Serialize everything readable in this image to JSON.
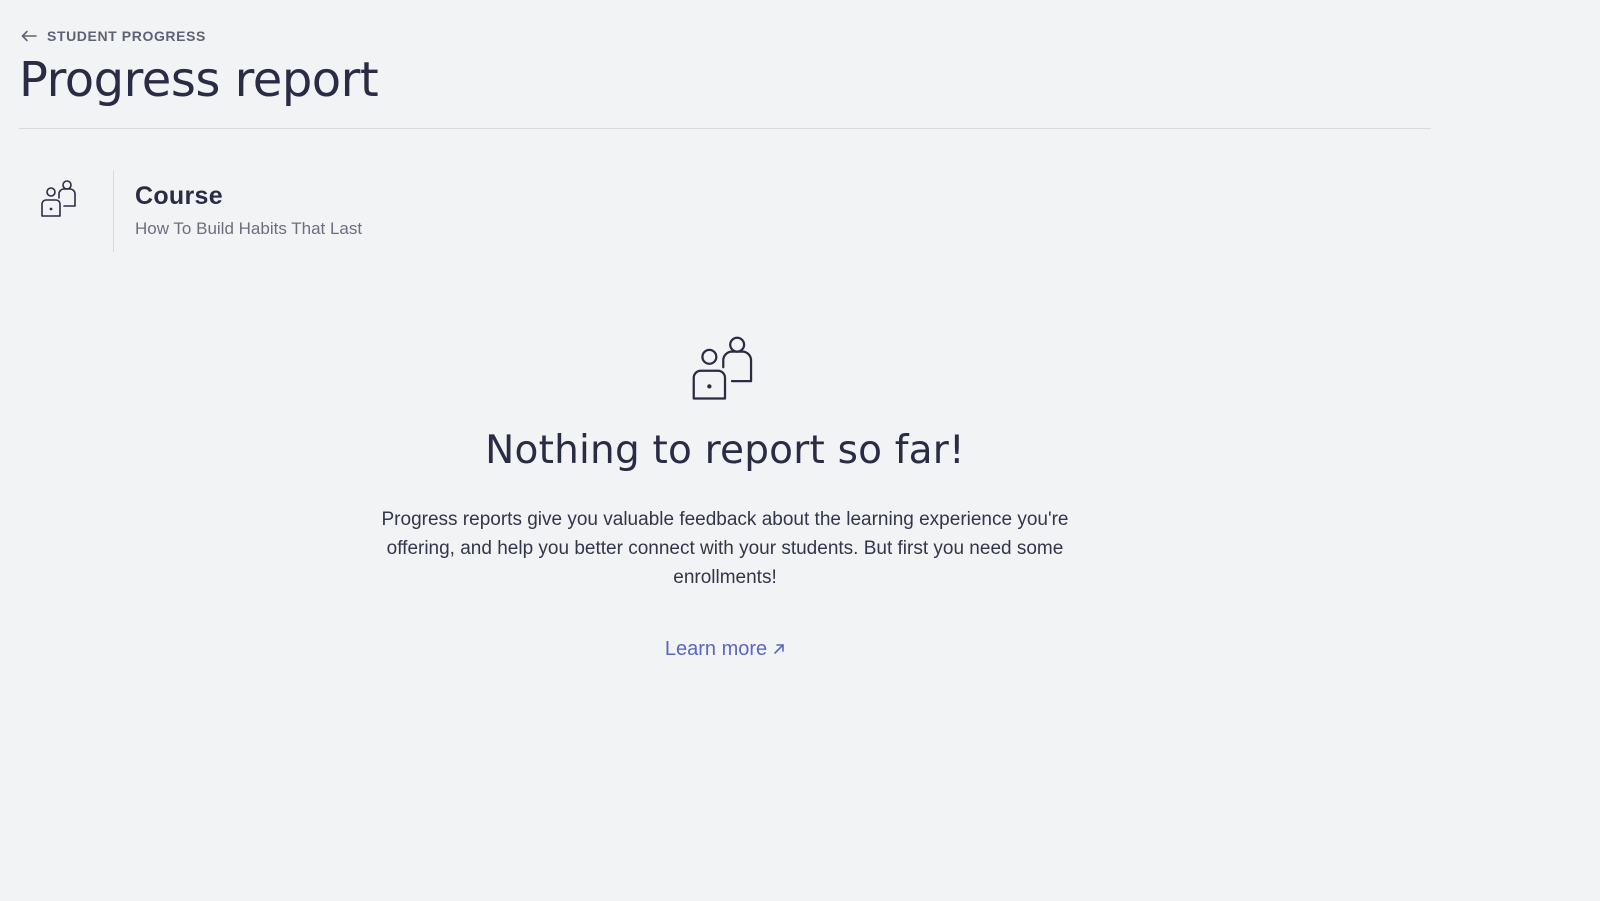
{
  "breadcrumb": {
    "label": "STUDENT PROGRESS",
    "icon": "arrow-left-icon"
  },
  "page": {
    "title": "Progress report"
  },
  "course": {
    "label": "Course",
    "name": "How To Build Habits That Last",
    "icon": "students-icon"
  },
  "empty_state": {
    "icon": "students-icon",
    "title": "Nothing to report so far!",
    "body": "Progress reports give you valuable feedback about the learning experience you're offering, and help you better connect with your students. But first you need some enrollments!",
    "link_label": "Learn more",
    "link_icon": "external-arrow-icon"
  },
  "colors": {
    "background": "#f2f3f5",
    "text": "#2a2c45",
    "muted": "#6b6e80",
    "link": "#5b67c2",
    "divider": "#d8dadf"
  }
}
